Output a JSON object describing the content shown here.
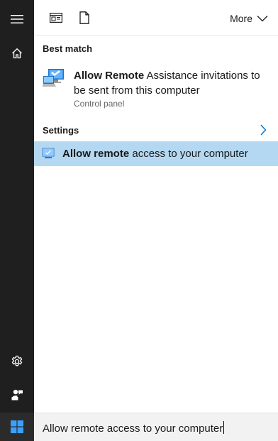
{
  "rail": {
    "menu_icon": "hamburger-icon",
    "home_icon": "home-icon",
    "settings_icon": "gear-icon",
    "feedback_icon": "feedback-icon",
    "start_icon": "windows-logo-icon"
  },
  "toolbar": {
    "documents_icon": "documents-filter-icon",
    "files_icon": "file-filter-icon",
    "more_label": "More"
  },
  "results": {
    "best_match_heading": "Best match",
    "best_match": {
      "title_bold": "Allow Remote",
      "title_rest": " Assistance invitations to be sent from this computer",
      "subtitle": "Control panel",
      "icon": "remote-assistance-icon"
    },
    "settings_heading": "Settings",
    "settings_items": [
      {
        "label_bold": "Allow remote",
        "label_rest": " access to your computer",
        "icon": "computer-icon",
        "selected": true
      }
    ]
  },
  "search": {
    "value": "Allow remote access to your computer"
  },
  "colors": {
    "rail_bg": "#1f1f1f",
    "selected_bg": "#b4d8f1",
    "accent": "#0078d7",
    "search_bg": "#f2f2f2"
  }
}
